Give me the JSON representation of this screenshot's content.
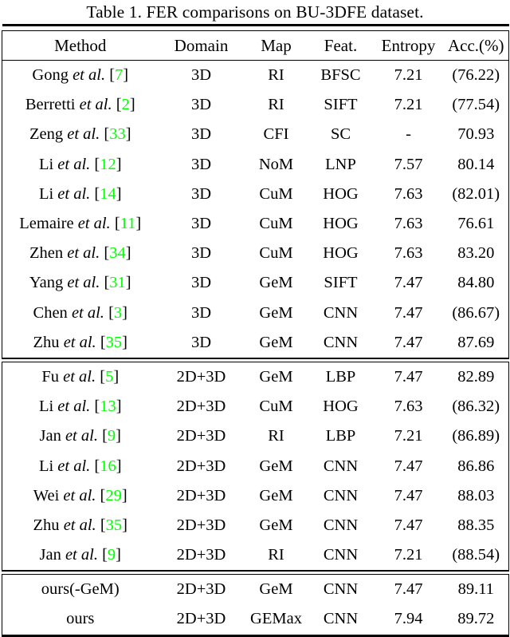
{
  "caption": "Table 1. FER comparisons on BU-3DFE dataset.",
  "colors": {
    "citation_green": "#00ff00",
    "text": "#000000",
    "background": "#ffffff"
  },
  "table": {
    "columns": [
      "Method",
      "Domain",
      "Map",
      "Feat.",
      "Entropy",
      "Acc.(%)"
    ],
    "groups": [
      {
        "name": "3d-methods",
        "rows": [
          {
            "author": "Gong",
            "etal": "et al.",
            "cite": "7",
            "domain": "3D",
            "map": "RI",
            "feat": "BFSC",
            "entropy": "7.21",
            "acc": "(76.22)"
          },
          {
            "author": "Berretti",
            "etal": "et al.",
            "cite": "2",
            "domain": "3D",
            "map": "RI",
            "feat": "SIFT",
            "entropy": "7.21",
            "acc": "(77.54)"
          },
          {
            "author": "Zeng",
            "etal": "et al.",
            "cite": "33",
            "domain": "3D",
            "map": "CFI",
            "feat": "SC",
            "entropy": "-",
            "acc": "70.93"
          },
          {
            "author": "Li",
            "etal": "et al.",
            "cite": "12",
            "domain": "3D",
            "map": "NoM",
            "feat": "LNP",
            "entropy": "7.57",
            "acc": "80.14"
          },
          {
            "author": "Li",
            "etal": "et al.",
            "cite": "14",
            "domain": "3D",
            "map": "CuM",
            "feat": "HOG",
            "entropy": "7.63",
            "acc": "(82.01)"
          },
          {
            "author": "Lemaire",
            "etal": "et al.",
            "cite": "11",
            "domain": "3D",
            "map": "CuM",
            "feat": "HOG",
            "entropy": "7.63",
            "acc": "76.61"
          },
          {
            "author": "Zhen",
            "etal": "et al.",
            "cite": "34",
            "domain": "3D",
            "map": "CuM",
            "feat": "HOG",
            "entropy": "7.63",
            "acc": "83.20"
          },
          {
            "author": "Yang",
            "etal": "et al.",
            "cite": "31",
            "domain": "3D",
            "map": "GeM",
            "feat": "SIFT",
            "entropy": "7.47",
            "acc": "84.80"
          },
          {
            "author": "Chen",
            "etal": "et al.",
            "cite": "3",
            "domain": "3D",
            "map": "GeM",
            "feat": "CNN",
            "entropy": "7.47",
            "acc": "(86.67)"
          },
          {
            "author": "Zhu",
            "etal": "et al.",
            "cite": "35",
            "domain": "3D",
            "map": "GeM",
            "feat": "CNN",
            "entropy": "7.47",
            "acc": "87.69"
          }
        ]
      },
      {
        "name": "2d-3d-methods",
        "rows": [
          {
            "author": "Fu",
            "etal": "et al.",
            "cite": "5",
            "domain": "2D+3D",
            "map": "GeM",
            "feat": "LBP",
            "entropy": "7.47",
            "acc": "82.89"
          },
          {
            "author": "Li",
            "etal": "et al.",
            "cite": "13",
            "domain": "2D+3D",
            "map": "CuM",
            "feat": "HOG",
            "entropy": "7.63",
            "acc": "(86.32)"
          },
          {
            "author": "Jan",
            "etal": "et al.",
            "cite": "9",
            "domain": "2D+3D",
            "map": "RI",
            "feat": "LBP",
            "entropy": "7.21",
            "acc": "(86.89)"
          },
          {
            "author": "Li",
            "etal": "et al.",
            "cite": "16",
            "domain": "2D+3D",
            "map": "GeM",
            "feat": "CNN",
            "entropy": "7.47",
            "acc": "86.86"
          },
          {
            "author": "Wei",
            "etal": "et al.",
            "cite": "29",
            "domain": "2D+3D",
            "map": "GeM",
            "feat": "CNN",
            "entropy": "7.47",
            "acc": "88.03"
          },
          {
            "author": "Zhu",
            "etal": "et al.",
            "cite": "35",
            "domain": "2D+3D",
            "map": "GeM",
            "feat": "CNN",
            "entropy": "7.47",
            "acc": "88.35"
          },
          {
            "author": "Jan",
            "etal": "et al.",
            "cite": "9",
            "domain": "2D+3D",
            "map": "RI",
            "feat": "CNN",
            "entropy": "7.21",
            "acc": "(88.54)"
          }
        ]
      },
      {
        "name": "ours-methods",
        "rows": [
          {
            "author": "ours(-GeM)",
            "etal": "",
            "cite": "",
            "domain": "2D+3D",
            "map": "GeM",
            "feat": "CNN",
            "entropy": "7.47",
            "entropy_bold": false,
            "acc": "89.11",
            "acc_bold": true
          },
          {
            "author": "ours",
            "etal": "",
            "cite": "",
            "domain": "2D+3D",
            "map": "GEMax",
            "feat": "CNN",
            "entropy": "7.94",
            "entropy_bold": true,
            "acc": "89.72",
            "acc_bold": true
          }
        ]
      }
    ]
  }
}
